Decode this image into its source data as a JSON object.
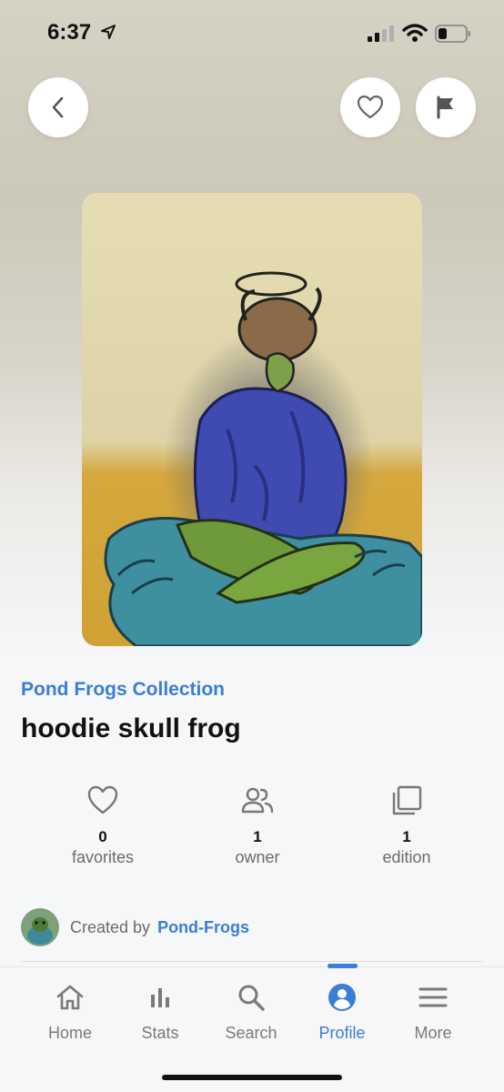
{
  "status_bar": {
    "time": "6:37"
  },
  "nft": {
    "collection": "Pond Frogs Collection",
    "title": "hoodie skull frog"
  },
  "stats": [
    {
      "value": "0",
      "label": "favorites",
      "icon": "heart-icon"
    },
    {
      "value": "1",
      "label": "owner",
      "icon": "users-icon"
    },
    {
      "value": "1",
      "label": "edition",
      "icon": "copies-icon"
    }
  ],
  "creator": {
    "prefix": "Created by",
    "name": "Pond-Frogs"
  },
  "tab_bar": {
    "active": "Profile",
    "tabs": [
      {
        "label": "Home",
        "icon": "home-icon"
      },
      {
        "label": "Stats",
        "icon": "bar-chart-icon"
      },
      {
        "label": "Search",
        "icon": "search-icon"
      },
      {
        "label": "Profile",
        "icon": "user-circle-icon"
      },
      {
        "label": "More",
        "icon": "menu-icon"
      }
    ]
  },
  "colors": {
    "accent": "#3b7dd8",
    "muted_text": "#6b6b6b"
  }
}
